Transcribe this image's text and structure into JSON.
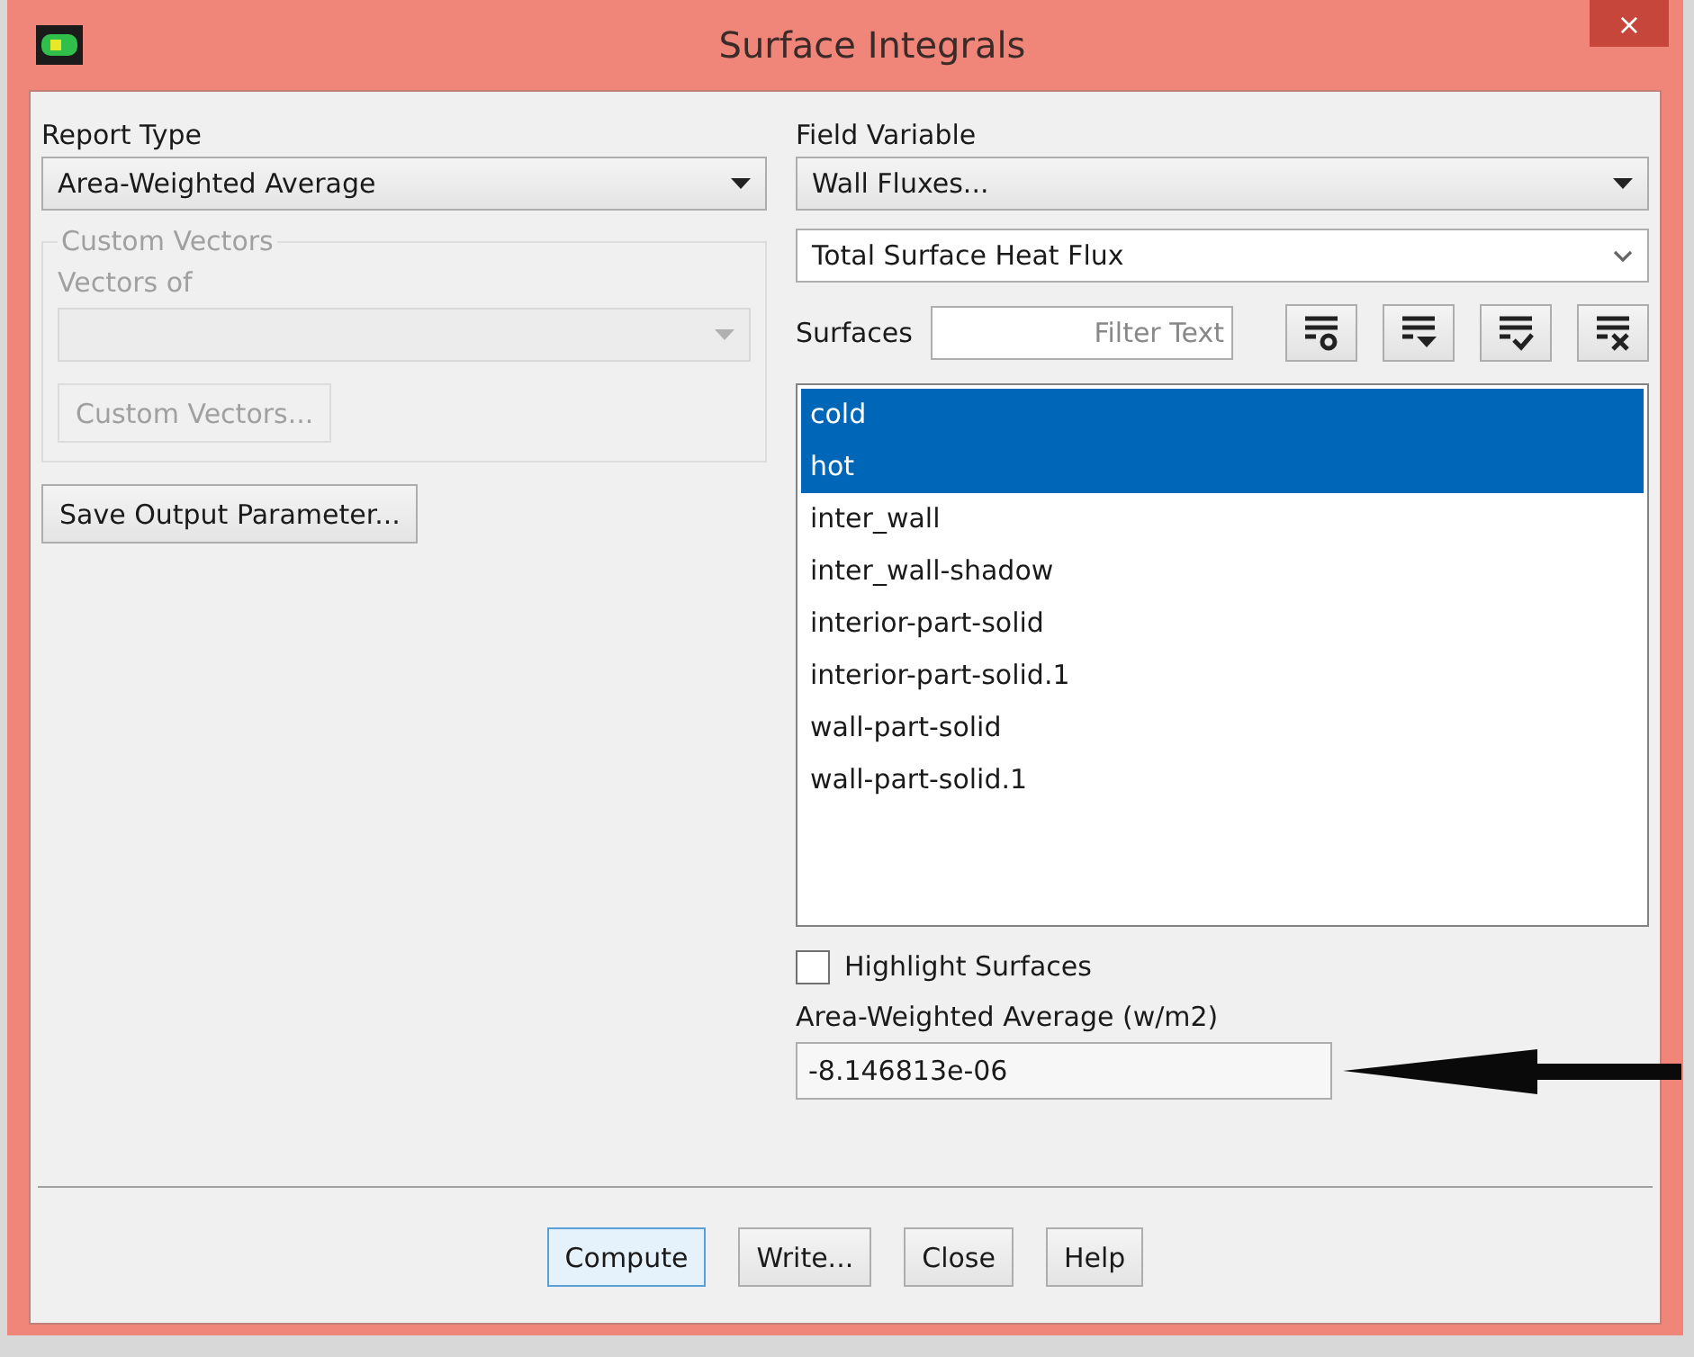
{
  "window": {
    "title": "Surface Integrals",
    "close": "×"
  },
  "report_type": {
    "label": "Report Type",
    "value": "Area-Weighted Average"
  },
  "custom_vectors": {
    "legend": "Custom Vectors",
    "vectors_of_label": "Vectors of",
    "disabled": true,
    "button": "Custom Vectors..."
  },
  "save_button": "Save Output Parameter...",
  "field_variable": {
    "label": "Field Variable",
    "category": "Wall Fluxes...",
    "quantity": "Total Surface Heat Flux"
  },
  "surfaces": {
    "label": "Surfaces",
    "filter_placeholder": "Filter Text",
    "items": [
      {
        "name": "cold",
        "selected": true
      },
      {
        "name": "hot",
        "selected": true
      },
      {
        "name": "inter_wall",
        "selected": false
      },
      {
        "name": "inter_wall-shadow",
        "selected": false
      },
      {
        "name": "interior-part-solid",
        "selected": false
      },
      {
        "name": "interior-part-solid.1",
        "selected": false
      },
      {
        "name": "wall-part-solid",
        "selected": false
      },
      {
        "name": "wall-part-solid.1",
        "selected": false
      }
    ]
  },
  "highlight_surfaces": {
    "label": "Highlight Surfaces",
    "checked": false
  },
  "result": {
    "label": "Area-Weighted Average (w/m2)",
    "value": "-8.146813e-06"
  },
  "buttons": [
    {
      "label": "Compute",
      "default": true
    },
    {
      "label": "Write...",
      "default": false
    },
    {
      "label": "Close",
      "default": false
    },
    {
      "label": "Help",
      "default": false
    }
  ]
}
